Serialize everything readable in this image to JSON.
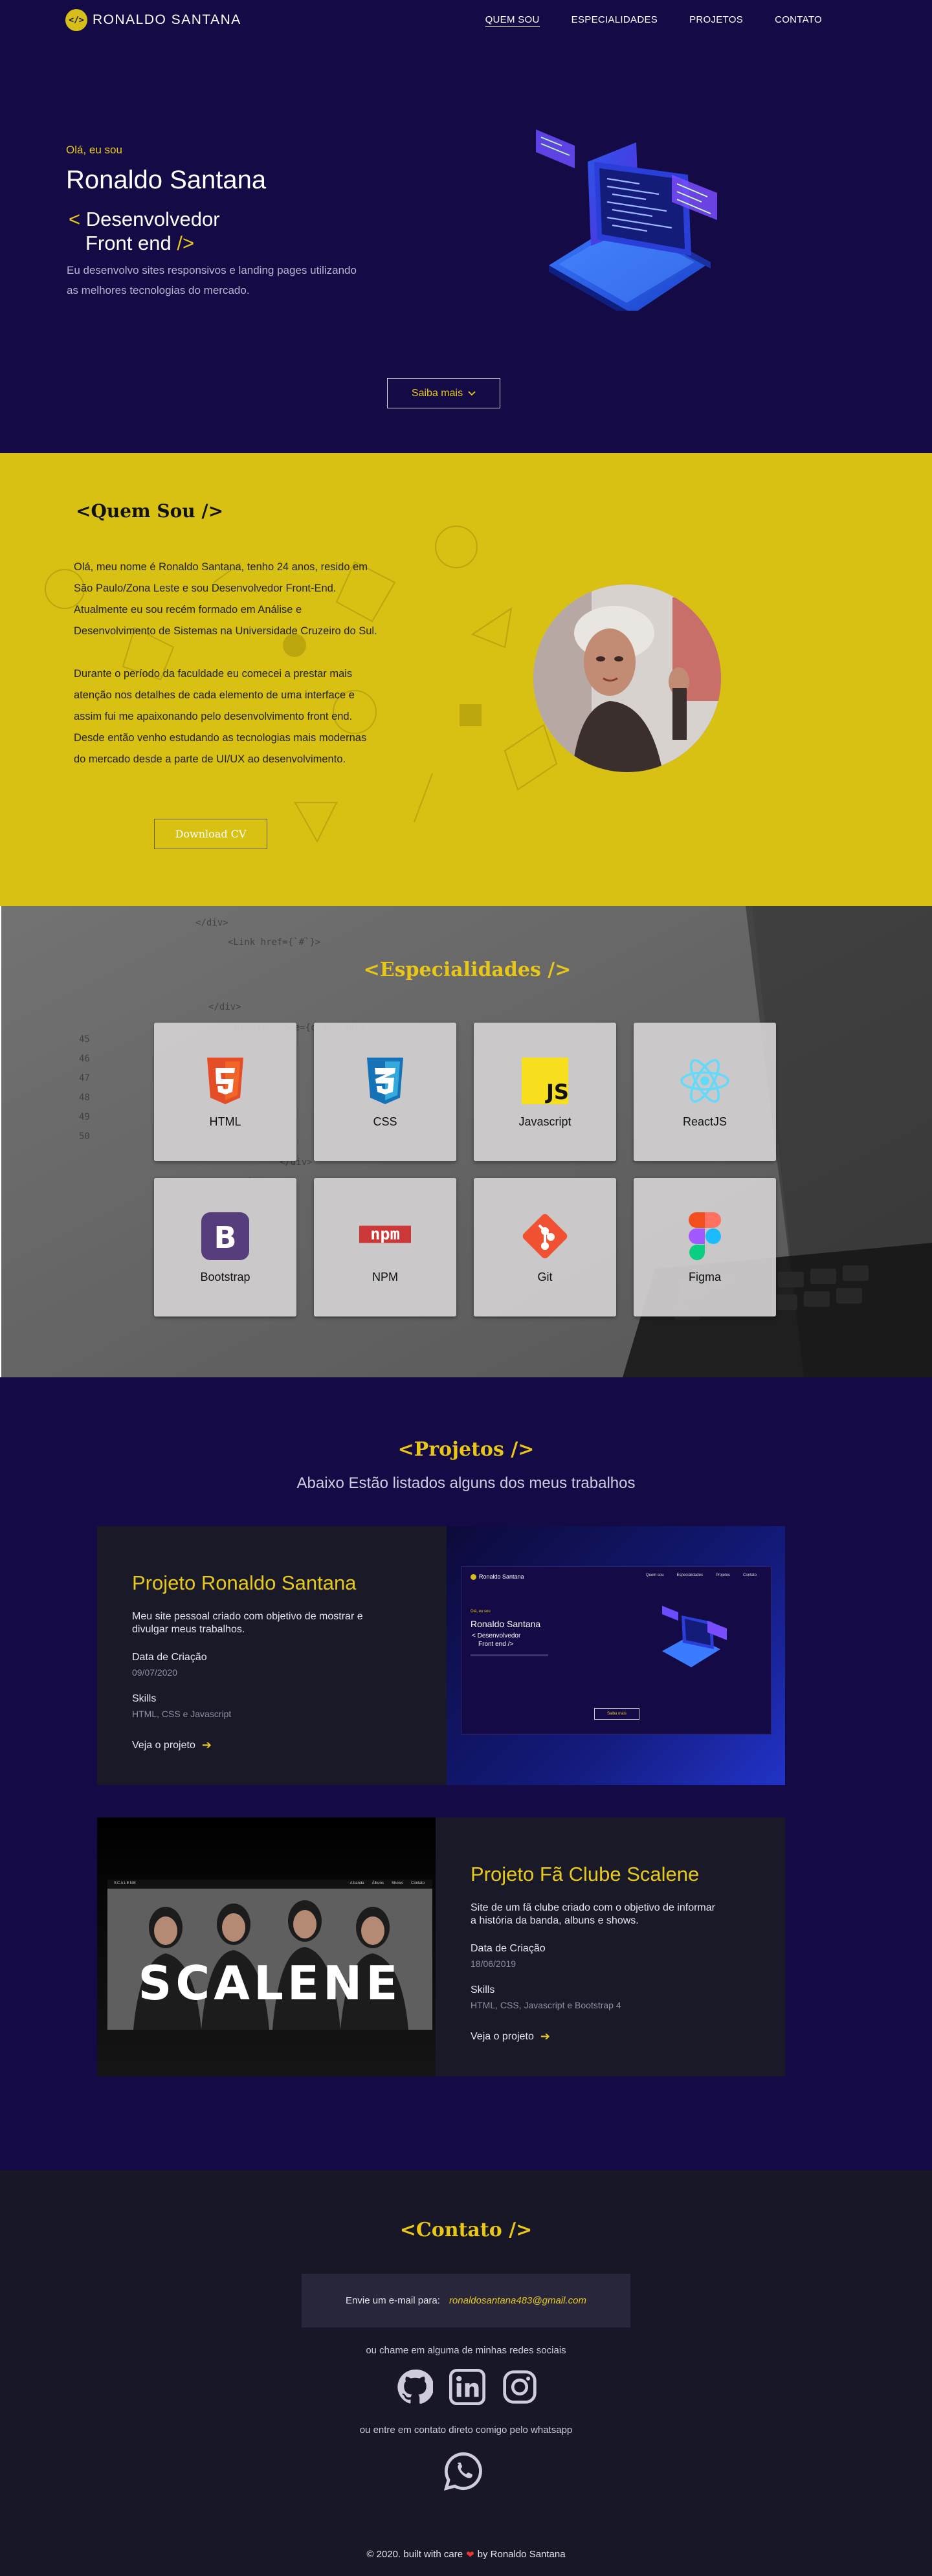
{
  "nav": {
    "logo_badge": "</>",
    "logo_text": "RONALDO SANTANA",
    "links": [
      "QUEM SOU",
      "ESPECIALIDADES",
      "PROJETOS",
      "CONTATO"
    ]
  },
  "hero": {
    "kicker": "Olá, eu sou",
    "name": "Ronaldo Santana",
    "role_open": "<",
    "role_line1": "Desenvolvedor",
    "role_line2": "Front end",
    "role_close": "/>",
    "description": "Eu desenvolvo sites responsivos e landing pages utilizando as melhores tecnologias do mercado.",
    "cta_label": "Saiba mais",
    "cta_icon": "chevron-down-icon"
  },
  "about": {
    "title": "<Quem Sou />",
    "paragraph1": "Olá, meu nome é Ronaldo Santana, tenho 24 anos, resido em São Paulo/Zona Leste e sou Desenvolvedor Front-End. Atualmente eu sou recém formado em Análise e Desenvolvimento de Sistemas na Universidade Cruzeiro do Sul.",
    "paragraph2": "Durante o período da faculdade eu comecei a prestar mais atenção nos detalhes de cada elemento de uma interface e assim fui me apaixonando pelo desenvolvimento front end. Desde então venho estudando as tecnologias mais modernas do mercado desde a parte de UI/UX ao desenvolvimento.",
    "button_label": "Download CV"
  },
  "skills": {
    "title": "<Especialidades />",
    "items": [
      {
        "name": "HTML",
        "icon": "html5-icon"
      },
      {
        "name": "CSS",
        "icon": "css3-icon"
      },
      {
        "name": "Javascript",
        "icon": "javascript-icon"
      },
      {
        "name": "ReactJS",
        "icon": "react-icon"
      },
      {
        "name": "Bootstrap",
        "icon": "bootstrap-icon"
      },
      {
        "name": "NPM",
        "icon": "npm-icon"
      },
      {
        "name": "Git",
        "icon": "git-icon"
      },
      {
        "name": "Figma",
        "icon": "figma-icon"
      }
    ]
  },
  "projects": {
    "title": "<Projetos />",
    "subtitle": "Abaixo Estão listados alguns dos meus trabalhos",
    "items": [
      {
        "name": "Projeto Ronaldo Santana",
        "description": "Meu site pessoal criado com objetivo de mostrar e divulgar meus trabalhos.",
        "date_label": "Data de Criação",
        "date": "09/07/2020",
        "skills_label": "Skills",
        "skills": "HTML, CSS e Javascript",
        "link_label": "Veja o projeto",
        "preview": {
          "logo": "Ronaldo Santana",
          "nav": [
            "Quem sou",
            "Especialidades",
            "Projetos",
            "Contato"
          ],
          "kicker": "Olá, eu sou",
          "name": "Ronaldo Santana",
          "role1": "< Desenvolvedor",
          "role2": "Front end />",
          "button": "Saiba mais"
        }
      },
      {
        "name": "Projeto Fã Clube Scalene",
        "description": "Site de um fã clube criado com o objetivo de informar a história da banda, albuns e shows.",
        "date_label": "Data de Criação",
        "date": "18/06/2019",
        "skills_label": "Skills",
        "skills": "HTML, CSS, Javascript e Bootstrap 4",
        "link_label": "Veja o projeto",
        "preview": {
          "logo": "SCALENE",
          "nav": [
            "A banda",
            "Álbuns",
            "Shows",
            "Contato"
          ],
          "band": "SCALENE"
        }
      }
    ]
  },
  "contact": {
    "title": "<Contato />",
    "email_label": "Envie um e-mail para:",
    "email": "ronaldosantana483@gmail.com",
    "social_note": "ou chame em alguma de minhas redes sociais",
    "socials": [
      "github-icon",
      "linkedin-icon",
      "instagram-icon"
    ],
    "whatsapp_note": "ou entre em contato direto comigo pelo whatsapp"
  },
  "footer": {
    "before": "© 2020. built with care",
    "heart": "❤",
    "after": "by Ronaldo Santana"
  },
  "colors": {
    "navy": "#140a45",
    "yellow": "#d8c112",
    "accent": "#e6c91c",
    "dark": "#181727"
  }
}
